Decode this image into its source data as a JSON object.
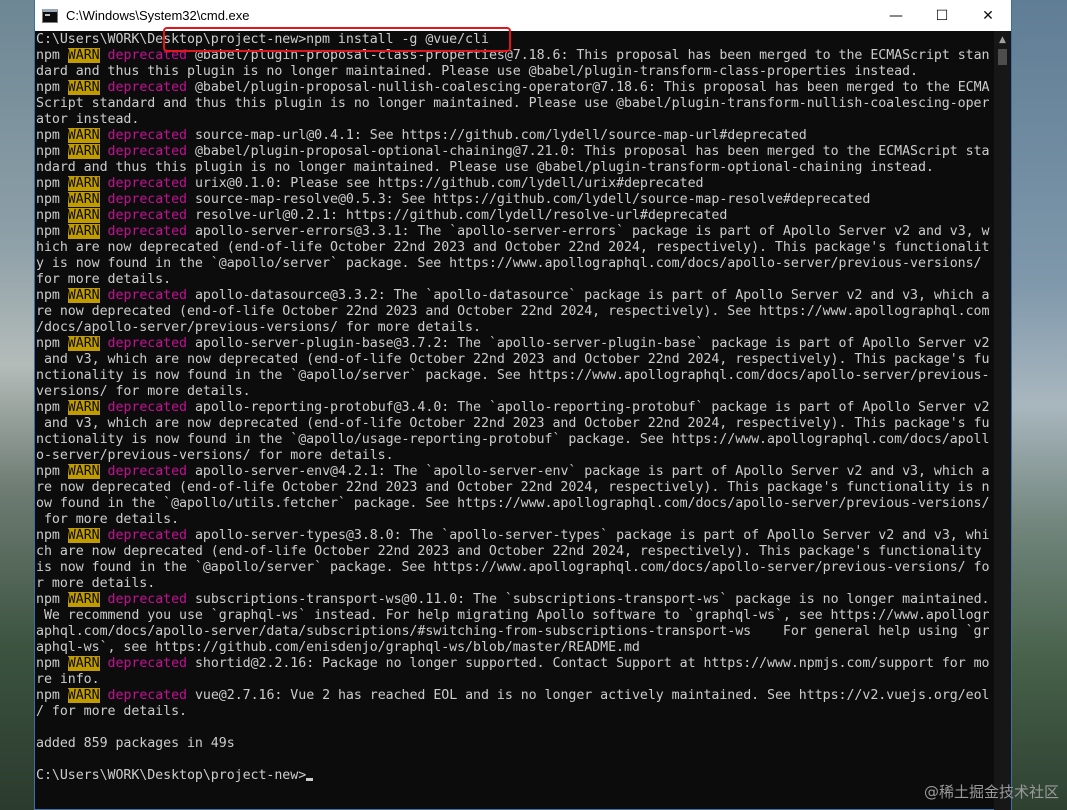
{
  "window": {
    "title": "C:\\Windows\\System32\\cmd.exe",
    "minimize": "—",
    "maximize": "☐",
    "close": "✕"
  },
  "colors": {
    "terminal_bg": "#0c0c0c",
    "terminal_fg": "#cccccc",
    "warn_bg": "#c19c00",
    "deprecated_fg": "#c50f94",
    "highlight_border": "#e0161c"
  },
  "terminal": {
    "lines": [
      [
        {
          "t": "C:\\Users\\WORK\\Desktop\\project-new>npm install -g @vue/cli"
        }
      ],
      [
        {
          "t": "npm "
        },
        {
          "t": "WARN",
          "c": "warn"
        },
        {
          "t": " "
        },
        {
          "t": "deprecated",
          "c": "dep"
        },
        {
          "t": " @babel/plugin-proposal-class-properties@7.18.6: This proposal has been merged to the ECMAScript stan"
        }
      ],
      [
        {
          "t": "dard and thus this plugin is no longer maintained. Please use @babel/plugin-transform-class-properties instead."
        }
      ],
      [
        {
          "t": "npm "
        },
        {
          "t": "WARN",
          "c": "warn"
        },
        {
          "t": " "
        },
        {
          "t": "deprecated",
          "c": "dep"
        },
        {
          "t": " @babel/plugin-proposal-nullish-coalescing-operator@7.18.6: This proposal has been merged to the ECMA"
        }
      ],
      [
        {
          "t": "Script standard and thus this plugin is no longer maintained. Please use @babel/plugin-transform-nullish-coalescing-oper"
        }
      ],
      [
        {
          "t": "ator instead."
        }
      ],
      [
        {
          "t": "npm "
        },
        {
          "t": "WARN",
          "c": "warn"
        },
        {
          "t": " "
        },
        {
          "t": "deprecated",
          "c": "dep"
        },
        {
          "t": " source-map-url@0.4.1: See https://github.com/lydell/source-map-url#deprecated"
        }
      ],
      [
        {
          "t": "npm "
        },
        {
          "t": "WARN",
          "c": "warn"
        },
        {
          "t": " "
        },
        {
          "t": "deprecated",
          "c": "dep"
        },
        {
          "t": " @babel/plugin-proposal-optional-chaining@7.21.0: This proposal has been merged to the ECMAScript sta"
        }
      ],
      [
        {
          "t": "ndard and thus this plugin is no longer maintained. Please use @babel/plugin-transform-optional-chaining instead."
        }
      ],
      [
        {
          "t": "npm "
        },
        {
          "t": "WARN",
          "c": "warn"
        },
        {
          "t": " "
        },
        {
          "t": "deprecated",
          "c": "dep"
        },
        {
          "t": " urix@0.1.0: Please see https://github.com/lydell/urix#deprecated"
        }
      ],
      [
        {
          "t": "npm "
        },
        {
          "t": "WARN",
          "c": "warn"
        },
        {
          "t": " "
        },
        {
          "t": "deprecated",
          "c": "dep"
        },
        {
          "t": " source-map-resolve@0.5.3: See https://github.com/lydell/source-map-resolve#deprecated"
        }
      ],
      [
        {
          "t": "npm "
        },
        {
          "t": "WARN",
          "c": "warn"
        },
        {
          "t": " "
        },
        {
          "t": "deprecated",
          "c": "dep"
        },
        {
          "t": " resolve-url@0.2.1: https://github.com/lydell/resolve-url#deprecated"
        }
      ],
      [
        {
          "t": "npm "
        },
        {
          "t": "WARN",
          "c": "warn"
        },
        {
          "t": " "
        },
        {
          "t": "deprecated",
          "c": "dep"
        },
        {
          "t": " apollo-server-errors@3.3.1: The `apollo-server-errors` package is part of Apollo Server v2 and v3, w"
        }
      ],
      [
        {
          "t": "hich are now deprecated (end-of-life October 22nd 2023 and October 22nd 2024, respectively). This package's functionalit"
        }
      ],
      [
        {
          "t": "y is now found in the `@apollo/server` package. See https://www.apollographql.com/docs/apollo-server/previous-versions/"
        }
      ],
      [
        {
          "t": "for more details."
        }
      ],
      [
        {
          "t": "npm "
        },
        {
          "t": "WARN",
          "c": "warn"
        },
        {
          "t": " "
        },
        {
          "t": "deprecated",
          "c": "dep"
        },
        {
          "t": " apollo-datasource@3.3.2: The `apollo-datasource` package is part of Apollo Server v2 and v3, which a"
        }
      ],
      [
        {
          "t": "re now deprecated (end-of-life October 22nd 2023 and October 22nd 2024, respectively). See https://www.apollographql.com"
        }
      ],
      [
        {
          "t": "/docs/apollo-server/previous-versions/ for more details."
        }
      ],
      [
        {
          "t": "npm "
        },
        {
          "t": "WARN",
          "c": "warn"
        },
        {
          "t": " "
        },
        {
          "t": "deprecated",
          "c": "dep"
        },
        {
          "t": " apollo-server-plugin-base@3.7.2: The `apollo-server-plugin-base` package is part of Apollo Server v2"
        }
      ],
      [
        {
          "t": " and v3, which are now deprecated (end-of-life October 22nd 2023 and October 22nd 2024, respectively). This package's fu"
        }
      ],
      [
        {
          "t": "nctionality is now found in the `@apollo/server` package. See https://www.apollographql.com/docs/apollo-server/previous-"
        }
      ],
      [
        {
          "t": "versions/ for more details."
        }
      ],
      [
        {
          "t": "npm "
        },
        {
          "t": "WARN",
          "c": "warn"
        },
        {
          "t": " "
        },
        {
          "t": "deprecated",
          "c": "dep"
        },
        {
          "t": " apollo-reporting-protobuf@3.4.0: The `apollo-reporting-protobuf` package is part of Apollo Server v2"
        }
      ],
      [
        {
          "t": " and v3, which are now deprecated (end-of-life October 22nd 2023 and October 22nd 2024, respectively). This package's fu"
        }
      ],
      [
        {
          "t": "nctionality is now found in the `@apollo/usage-reporting-protobuf` package. See https://www.apollographql.com/docs/apoll"
        }
      ],
      [
        {
          "t": "o-server/previous-versions/ for more details."
        }
      ],
      [
        {
          "t": "npm "
        },
        {
          "t": "WARN",
          "c": "warn"
        },
        {
          "t": " "
        },
        {
          "t": "deprecated",
          "c": "dep"
        },
        {
          "t": " apollo-server-env@4.2.1: The `apollo-server-env` package is part of Apollo Server v2 and v3, which a"
        }
      ],
      [
        {
          "t": "re now deprecated (end-of-life October 22nd 2023 and October 22nd 2024, respectively). This package's functionality is n"
        }
      ],
      [
        {
          "t": "ow found in the `@apollo/utils.fetcher` package. See https://www.apollographql.com/docs/apollo-server/previous-versions/"
        }
      ],
      [
        {
          "t": " for more details."
        }
      ],
      [
        {
          "t": "npm "
        },
        {
          "t": "WARN",
          "c": "warn"
        },
        {
          "t": " "
        },
        {
          "t": "deprecated",
          "c": "dep"
        },
        {
          "t": " apollo-server-types@3.8.0: The `apollo-server-types` package is part of Apollo Server v2 and v3, whi"
        }
      ],
      [
        {
          "t": "ch are now deprecated (end-of-life October 22nd 2023 and October 22nd 2024, respectively). This package's functionality"
        }
      ],
      [
        {
          "t": "is now found in the `@apollo/server` package. See https://www.apollographql.com/docs/apollo-server/previous-versions/ fo"
        }
      ],
      [
        {
          "t": "r more details."
        }
      ],
      [
        {
          "t": "npm "
        },
        {
          "t": "WARN",
          "c": "warn"
        },
        {
          "t": " "
        },
        {
          "t": "deprecated",
          "c": "dep"
        },
        {
          "t": " subscriptions-transport-ws@0.11.0: The `subscriptions-transport-ws` package is no longer maintained."
        }
      ],
      [
        {
          "t": " We recommend you use `graphql-ws` instead. For help migrating Apollo software to `graphql-ws`, see https://www.apollogr"
        }
      ],
      [
        {
          "t": "aphql.com/docs/apollo-server/data/subscriptions/#switching-from-subscriptions-transport-ws    For general help using `gr"
        }
      ],
      [
        {
          "t": "aphql-ws`, see https://github.com/enisdenjo/graphql-ws/blob/master/README.md"
        }
      ],
      [
        {
          "t": "npm "
        },
        {
          "t": "WARN",
          "c": "warn"
        },
        {
          "t": " "
        },
        {
          "t": "deprecated",
          "c": "dep"
        },
        {
          "t": " shortid@2.2.16: Package no longer supported. Contact Support at https://www.npmjs.com/support for mo"
        }
      ],
      [
        {
          "t": "re info."
        }
      ],
      [
        {
          "t": "npm "
        },
        {
          "t": "WARN",
          "c": "warn"
        },
        {
          "t": " "
        },
        {
          "t": "deprecated",
          "c": "dep"
        },
        {
          "t": " vue@2.7.16: Vue 2 has reached EOL and is no longer actively maintained. See https://v2.vuejs.org/eol"
        }
      ],
      [
        {
          "t": "/ for more details."
        }
      ],
      [
        {
          "t": ""
        }
      ],
      [
        {
          "t": "added 859 packages in 49s"
        }
      ],
      [
        {
          "t": ""
        }
      ],
      [
        {
          "t": "C:\\Users\\WORK\\Desktop\\project-new>"
        },
        {
          "t": "",
          "c": "cursor"
        }
      ]
    ]
  },
  "watermark": "@稀土掘金技术社区",
  "scrollbar": {
    "up_arrow": "▲"
  }
}
